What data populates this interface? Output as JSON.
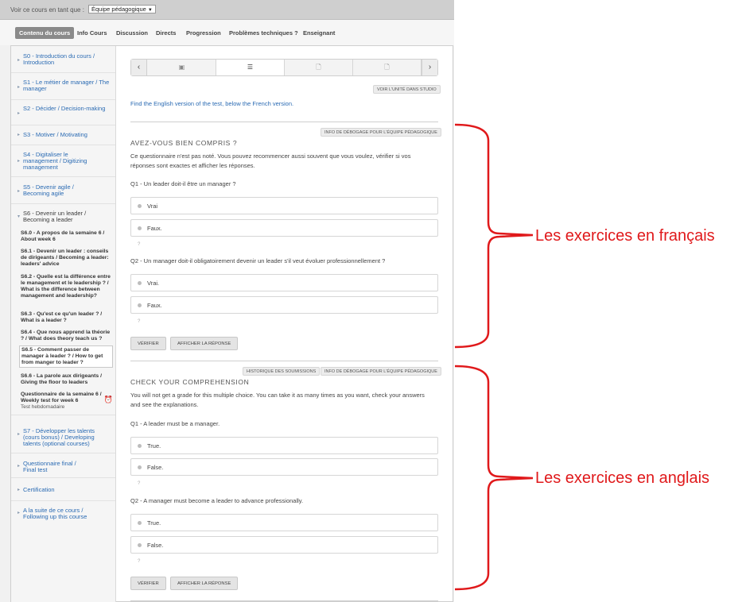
{
  "viewbar": {
    "label": "Voir ce cours en tant que :",
    "role_value": "Équipe pédagogique"
  },
  "tabs": [
    {
      "label": "Contenu du cours"
    },
    {
      "label": "Info Cours"
    },
    {
      "label": "Discussion"
    },
    {
      "label": "Directs"
    },
    {
      "label": "Progression"
    },
    {
      "label": "Problèmes techniques ?"
    },
    {
      "label": "Enseignant"
    }
  ],
  "sidebar": {
    "sections": [
      {
        "title": "S0 - Introduction du cours / Introduction"
      },
      {
        "title": "S1 - Le métier de manager / The manager"
      },
      {
        "title": "S2 - Décider / Decision-making"
      },
      {
        "title": "S3 - Motiver / Motivating"
      },
      {
        "title": "S4 - Digitaliser le management / Digitizing management"
      },
      {
        "title": "S5 - Devenir agile / Becoming agile"
      },
      {
        "title": "S6 - Devenir un leader / Becoming a leader"
      },
      {
        "title": "S7 - Développer les talents (cours bonus) / Developing talents (optional courses)"
      },
      {
        "title": "Questionnaire final / Final test"
      },
      {
        "title": "Certification"
      },
      {
        "title": "A la suite de ce cours / Following up this course"
      }
    ],
    "subsections": [
      {
        "title": "S6.0 - A propos de la semaine 6 / About week 6"
      },
      {
        "title": "S6.1 - Devenir un leader : conseils de dirigeants / Becoming a leader: leaders' advice"
      },
      {
        "title": "S6.2 - Quelle est la différence entre le management et le leadership ? / What is the difference between management and leadership?"
      },
      {
        "title": "S6.3 - Qu'est ce qu'un leader ? / What is a leader ?"
      },
      {
        "title": "S6.4 - Que nous apprend la théorie ? / What does theory teach us ?"
      },
      {
        "title": "S6.5 - Comment passer de manager à leader ? / How to get from manger to leader ?"
      },
      {
        "title": "S6.6 - La parole aux dirigeants / Giving the floor to leaders"
      },
      {
        "title": "Questionnaire de la semaine 6 / Weekly test for week 6",
        "subtitle": "Test hebdomadaire"
      }
    ]
  },
  "content": {
    "studio_button": "Voir l'unité dans Studio",
    "english_link": "Find the English version of the test, below the French version.",
    "debug_button": "Info de débogage pour l'équipe pédagogique",
    "history_button": "Historique des soumissions",
    "fr": {
      "title": "Avez-vous bien compris ?",
      "intro": "Ce questionnaire n'est pas noté. Vous pouvez recommencer aussi souvent que vous voulez, vérifier si vos réponses sont exactes et afficher les réponses.",
      "q1": "Q1 - Un leader doit-il être un manager ?",
      "q1_options": [
        "Vrai",
        "Faux."
      ],
      "q2": "Q2 - Un manager doit-il obligatoirement devenir un leader s'il veut évoluer professionnellement ?",
      "q2_options": [
        "Vrai.",
        "Faux."
      ],
      "check": "Vérifier",
      "show": "Afficher la réponse"
    },
    "en": {
      "title": "Check your comprehension",
      "intro": "You will not get a grade for this multiple choice. You can take it as many times as you want, check your answers and see the explanations.",
      "q1": "Q1 - A leader must be a manager.",
      "q1_options": [
        "True.",
        "False."
      ],
      "q2": "Q2 - A manager must become a leader to advance professionally.",
      "q2_options": [
        "True.",
        "False."
      ],
      "check": "Vérifier",
      "show": "Afficher la réponse"
    },
    "help_mark": "?"
  },
  "annotations": {
    "fr_label": "Les exercices en français",
    "en_label": "Les exercices en anglais",
    "color": "#e0191b"
  }
}
